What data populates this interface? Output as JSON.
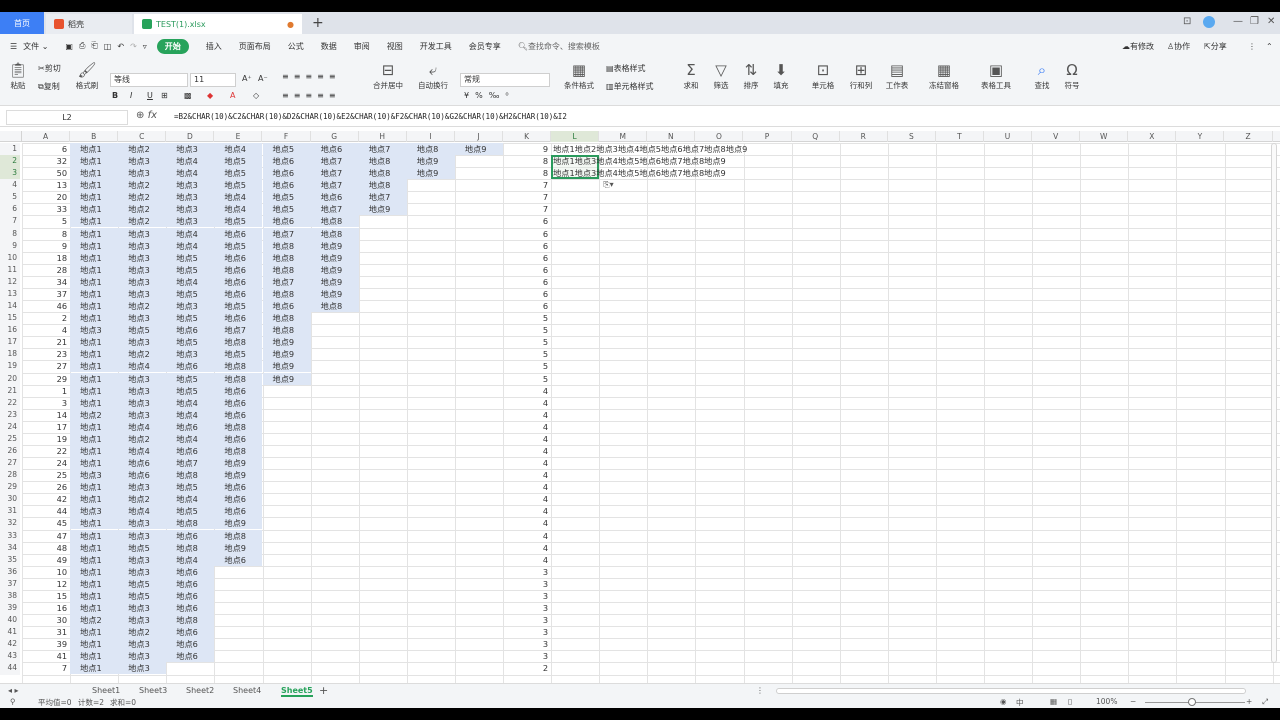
{
  "tabs": {
    "home": "首页",
    "docs": "稻壳",
    "file": "TEST(1).xlsx"
  },
  "menu": {
    "file": "文件",
    "items": [
      "开始",
      "插入",
      "页面布局",
      "公式",
      "数据",
      "审阅",
      "视图",
      "开发工具",
      "会员专享"
    ],
    "search": "查找命令、搜索模板",
    "right": [
      "有修改",
      "协作",
      "分享"
    ]
  },
  "ribbon": {
    "paste": "粘贴",
    "cut": "剪切",
    "copy": "复制",
    "format_painter": "格式刷",
    "font": "等线",
    "size": "11",
    "numfmt": "常规",
    "merge": "合并居中",
    "wrap": "自动换行",
    "table_style": "表格样式",
    "cond_fmt": "条件格式",
    "cell_style": "单元格样式",
    "sum": "求和",
    "filter": "筛选",
    "sort": "排序",
    "fill": "填充",
    "cell": "单元格",
    "rowcol": "行和列",
    "sheet": "工作表",
    "freeze": "冻结窗格",
    "table_tool": "表格工具",
    "find": "查找",
    "symbol": "符号"
  },
  "formula_bar": {
    "name_box": "L2",
    "fx": "fx",
    "formula": "=B2&CHAR(10)&C2&CHAR(10)&D2&CHAR(10)&E2&CHAR(10)&F2&CHAR(10)&G2&CHAR(10)&H2&CHAR(10)&I2"
  },
  "columns": [
    "A",
    "B",
    "C",
    "D",
    "E",
    "F",
    "G",
    "H",
    "I",
    "J",
    "K",
    "L",
    "M",
    "N",
    "O",
    "P",
    "Q",
    "R",
    "S",
    "T",
    "U",
    "V",
    "W",
    "X",
    "Y",
    "Z"
  ],
  "rows": [
    {
      "a": "6",
      "b": "地点1",
      "c": "地点2",
      "d": "地点3",
      "e": "地点4",
      "f": "地点5",
      "g": "地点6",
      "h": "地点7",
      "i": "地点8",
      "j": "地点9",
      "k": "9"
    },
    {
      "a": "32",
      "b": "地点1",
      "c": "地点3",
      "d": "地点4",
      "e": "地点5",
      "f": "地点6",
      "g": "地点7",
      "h": "地点8",
      "i": "地点9",
      "j": "",
      "k": "8"
    },
    {
      "a": "50",
      "b": "地点1",
      "c": "地点3",
      "d": "地点4",
      "e": "地点5",
      "f": "地点6",
      "g": "地点7",
      "h": "地点8",
      "i": "地点9",
      "j": "",
      "k": "8"
    },
    {
      "a": "13",
      "b": "地点1",
      "c": "地点2",
      "d": "地点3",
      "e": "地点5",
      "f": "地点6",
      "g": "地点7",
      "h": "地点8",
      "i": "",
      "j": "",
      "k": "7"
    },
    {
      "a": "20",
      "b": "地点1",
      "c": "地点2",
      "d": "地点3",
      "e": "地点4",
      "f": "地点5",
      "g": "地点6",
      "h": "地点7",
      "i": "",
      "j": "",
      "k": "7"
    },
    {
      "a": "33",
      "b": "地点1",
      "c": "地点2",
      "d": "地点3",
      "e": "地点4",
      "f": "地点5",
      "g": "地点7",
      "h": "地点9",
      "i": "",
      "j": "",
      "k": "7"
    },
    {
      "a": "5",
      "b": "地点1",
      "c": "地点2",
      "d": "地点3",
      "e": "地点5",
      "f": "地点6",
      "g": "地点8",
      "h": "",
      "i": "",
      "j": "",
      "k": "6"
    },
    {
      "a": "8",
      "b": "地点1",
      "c": "地点3",
      "d": "地点4",
      "e": "地点6",
      "f": "地点7",
      "g": "地点8",
      "h": "",
      "i": "",
      "j": "",
      "k": "6"
    },
    {
      "a": "9",
      "b": "地点1",
      "c": "地点3",
      "d": "地点4",
      "e": "地点5",
      "f": "地点8",
      "g": "地点9",
      "h": "",
      "i": "",
      "j": "",
      "k": "6"
    },
    {
      "a": "18",
      "b": "地点1",
      "c": "地点3",
      "d": "地点5",
      "e": "地点6",
      "f": "地点8",
      "g": "地点9",
      "h": "",
      "i": "",
      "j": "",
      "k": "6"
    },
    {
      "a": "28",
      "b": "地点1",
      "c": "地点3",
      "d": "地点5",
      "e": "地点6",
      "f": "地点8",
      "g": "地点9",
      "h": "",
      "i": "",
      "j": "",
      "k": "6"
    },
    {
      "a": "34",
      "b": "地点1",
      "c": "地点3",
      "d": "地点4",
      "e": "地点6",
      "f": "地点7",
      "g": "地点9",
      "h": "",
      "i": "",
      "j": "",
      "k": "6"
    },
    {
      "a": "37",
      "b": "地点1",
      "c": "地点3",
      "d": "地点5",
      "e": "地点6",
      "f": "地点8",
      "g": "地点9",
      "h": "",
      "i": "",
      "j": "",
      "k": "6"
    },
    {
      "a": "46",
      "b": "地点1",
      "c": "地点2",
      "d": "地点3",
      "e": "地点5",
      "f": "地点6",
      "g": "地点8",
      "h": "",
      "i": "",
      "j": "",
      "k": "6"
    },
    {
      "a": "2",
      "b": "地点1",
      "c": "地点3",
      "d": "地点5",
      "e": "地点6",
      "f": "地点8",
      "g": "",
      "h": "",
      "i": "",
      "j": "",
      "k": "5"
    },
    {
      "a": "4",
      "b": "地点3",
      "c": "地点5",
      "d": "地点6",
      "e": "地点7",
      "f": "地点8",
      "g": "",
      "h": "",
      "i": "",
      "j": "",
      "k": "5"
    },
    {
      "a": "21",
      "b": "地点1",
      "c": "地点3",
      "d": "地点5",
      "e": "地点8",
      "f": "地点9",
      "g": "",
      "h": "",
      "i": "",
      "j": "",
      "k": "5"
    },
    {
      "a": "23",
      "b": "地点1",
      "c": "地点2",
      "d": "地点3",
      "e": "地点5",
      "f": "地点9",
      "g": "",
      "h": "",
      "i": "",
      "j": "",
      "k": "5"
    },
    {
      "a": "27",
      "b": "地点1",
      "c": "地点4",
      "d": "地点6",
      "e": "地点8",
      "f": "地点9",
      "g": "",
      "h": "",
      "i": "",
      "j": "",
      "k": "5"
    },
    {
      "a": "29",
      "b": "地点1",
      "c": "地点3",
      "d": "地点5",
      "e": "地点8",
      "f": "地点9",
      "g": "",
      "h": "",
      "i": "",
      "j": "",
      "k": "5"
    },
    {
      "a": "1",
      "b": "地点1",
      "c": "地点3",
      "d": "地点5",
      "e": "地点6",
      "f": "",
      "g": "",
      "h": "",
      "i": "",
      "j": "",
      "k": "4"
    },
    {
      "a": "3",
      "b": "地点1",
      "c": "地点3",
      "d": "地点4",
      "e": "地点6",
      "f": "",
      "g": "",
      "h": "",
      "i": "",
      "j": "",
      "k": "4"
    },
    {
      "a": "14",
      "b": "地点2",
      "c": "地点3",
      "d": "地点4",
      "e": "地点6",
      "f": "",
      "g": "",
      "h": "",
      "i": "",
      "j": "",
      "k": "4"
    },
    {
      "a": "17",
      "b": "地点1",
      "c": "地点4",
      "d": "地点6",
      "e": "地点8",
      "f": "",
      "g": "",
      "h": "",
      "i": "",
      "j": "",
      "k": "4"
    },
    {
      "a": "19",
      "b": "地点1",
      "c": "地点2",
      "d": "地点4",
      "e": "地点6",
      "f": "",
      "g": "",
      "h": "",
      "i": "",
      "j": "",
      "k": "4"
    },
    {
      "a": "22",
      "b": "地点1",
      "c": "地点4",
      "d": "地点6",
      "e": "地点8",
      "f": "",
      "g": "",
      "h": "",
      "i": "",
      "j": "",
      "k": "4"
    },
    {
      "a": "24",
      "b": "地点1",
      "c": "地点6",
      "d": "地点7",
      "e": "地点9",
      "f": "",
      "g": "",
      "h": "",
      "i": "",
      "j": "",
      "k": "4"
    },
    {
      "a": "25",
      "b": "地点3",
      "c": "地点6",
      "d": "地点8",
      "e": "地点9",
      "f": "",
      "g": "",
      "h": "",
      "i": "",
      "j": "",
      "k": "4"
    },
    {
      "a": "26",
      "b": "地点1",
      "c": "地点3",
      "d": "地点5",
      "e": "地点6",
      "f": "",
      "g": "",
      "h": "",
      "i": "",
      "j": "",
      "k": "4"
    },
    {
      "a": "42",
      "b": "地点1",
      "c": "地点2",
      "d": "地点4",
      "e": "地点6",
      "f": "",
      "g": "",
      "h": "",
      "i": "",
      "j": "",
      "k": "4"
    },
    {
      "a": "44",
      "b": "地点3",
      "c": "地点4",
      "d": "地点5",
      "e": "地点6",
      "f": "",
      "g": "",
      "h": "",
      "i": "",
      "j": "",
      "k": "4"
    },
    {
      "a": "45",
      "b": "地点1",
      "c": "地点3",
      "d": "地点8",
      "e": "地点9",
      "f": "",
      "g": "",
      "h": "",
      "i": "",
      "j": "",
      "k": "4"
    },
    {
      "a": "47",
      "b": "地点1",
      "c": "地点3",
      "d": "地点6",
      "e": "地点8",
      "f": "",
      "g": "",
      "h": "",
      "i": "",
      "j": "",
      "k": "4"
    },
    {
      "a": "48",
      "b": "地点1",
      "c": "地点5",
      "d": "地点8",
      "e": "地点9",
      "f": "",
      "g": "",
      "h": "",
      "i": "",
      "j": "",
      "k": "4"
    },
    {
      "a": "49",
      "b": "地点1",
      "c": "地点3",
      "d": "地点4",
      "e": "地点6",
      "f": "",
      "g": "",
      "h": "",
      "i": "",
      "j": "",
      "k": "4"
    },
    {
      "a": "10",
      "b": "地点1",
      "c": "地点3",
      "d": "地点6",
      "e": "",
      "f": "",
      "g": "",
      "h": "",
      "i": "",
      "j": "",
      "k": "3"
    },
    {
      "a": "12",
      "b": "地点1",
      "c": "地点5",
      "d": "地点6",
      "e": "",
      "f": "",
      "g": "",
      "h": "",
      "i": "",
      "j": "",
      "k": "3"
    },
    {
      "a": "15",
      "b": "地点1",
      "c": "地点5",
      "d": "地点6",
      "e": "",
      "f": "",
      "g": "",
      "h": "",
      "i": "",
      "j": "",
      "k": "3"
    },
    {
      "a": "16",
      "b": "地点1",
      "c": "地点3",
      "d": "地点6",
      "e": "",
      "f": "",
      "g": "",
      "h": "",
      "i": "",
      "j": "",
      "k": "3"
    },
    {
      "a": "30",
      "b": "地点2",
      "c": "地点3",
      "d": "地点8",
      "e": "",
      "f": "",
      "g": "",
      "h": "",
      "i": "",
      "j": "",
      "k": "3"
    },
    {
      "a": "31",
      "b": "地点1",
      "c": "地点2",
      "d": "地点6",
      "e": "",
      "f": "",
      "g": "",
      "h": "",
      "i": "",
      "j": "",
      "k": "3"
    },
    {
      "a": "39",
      "b": "地点1",
      "c": "地点3",
      "d": "地点6",
      "e": "",
      "f": "",
      "g": "",
      "h": "",
      "i": "",
      "j": "",
      "k": "3"
    },
    {
      "a": "41",
      "b": "地点1",
      "c": "地点3",
      "d": "地点6",
      "e": "",
      "f": "",
      "g": "",
      "h": "",
      "i": "",
      "j": "",
      "k": "3"
    },
    {
      "a": "7",
      "b": "地点1",
      "c": "地点3",
      "d": "",
      "e": "",
      "f": "",
      "g": "",
      "h": "",
      "i": "",
      "j": "",
      "k": "2"
    }
  ],
  "l_column": [
    "地点1地点2地点3地点4地点5地点6地点7地点8地点9",
    "地点1地点3地点4地点5地点6地点7地点8地点9",
    "地点1地点3地点4地点5地点6地点7地点8地点9"
  ],
  "sheets": [
    "Sheet1",
    "Sheet3",
    "Sheet2",
    "Sheet4",
    "Sheet5"
  ],
  "active_sheet": "Sheet5",
  "status": {
    "avg": "平均值=0",
    "count": "计数=2",
    "sum": "求和=0",
    "zoom": "100%"
  },
  "colors": {
    "accent": "#27a35b",
    "selection": "#dde6f5",
    "tab_blue": "#3d7ff5"
  }
}
